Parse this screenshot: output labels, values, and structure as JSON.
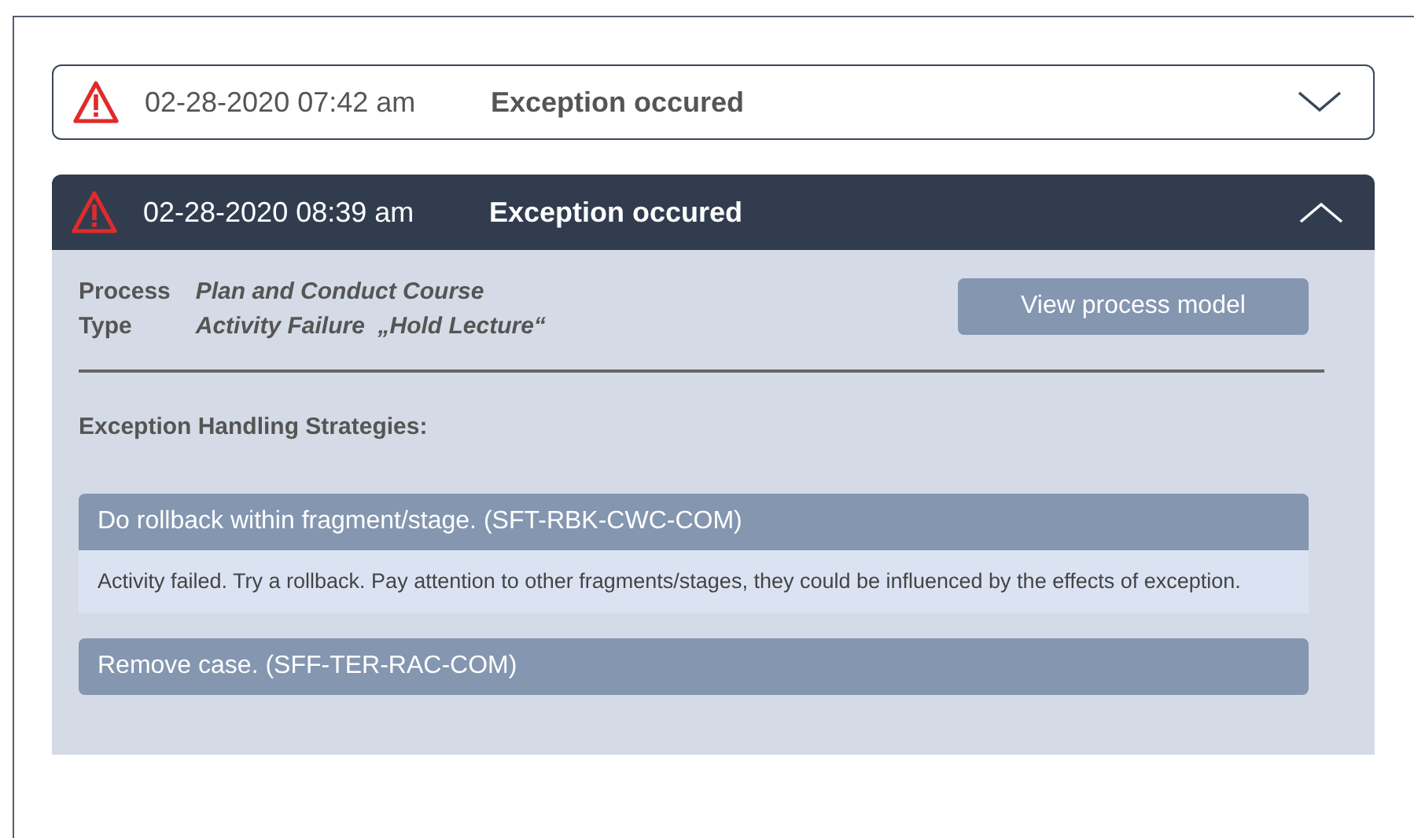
{
  "exceptions": [
    {
      "expanded": false,
      "time": "02-28-2020 07:42 am",
      "title": "Exception occured"
    },
    {
      "expanded": true,
      "time": "02-28-2020 08:39 am",
      "title": "Exception occured",
      "details": [
        {
          "label": "Process",
          "value": "Plan and Conduct Course"
        },
        {
          "label": "Type",
          "value": "Activity Failure  „Hold Lecture“"
        }
      ],
      "action": "View process model",
      "strategies_heading": "Exception Handling Strategies:",
      "strategies": [
        {
          "expanded": true,
          "title": "Do rollback within fragment/stage. (SFT-RBK-CWC-COM)",
          "description": "Activity failed. Try a rollback. Pay attention to other fragments/stages, they could be influenced by the effects of exception."
        },
        {
          "expanded": false,
          "title": "Remove case. (SFF-TER-RAC-COM)"
        }
      ]
    }
  ]
}
